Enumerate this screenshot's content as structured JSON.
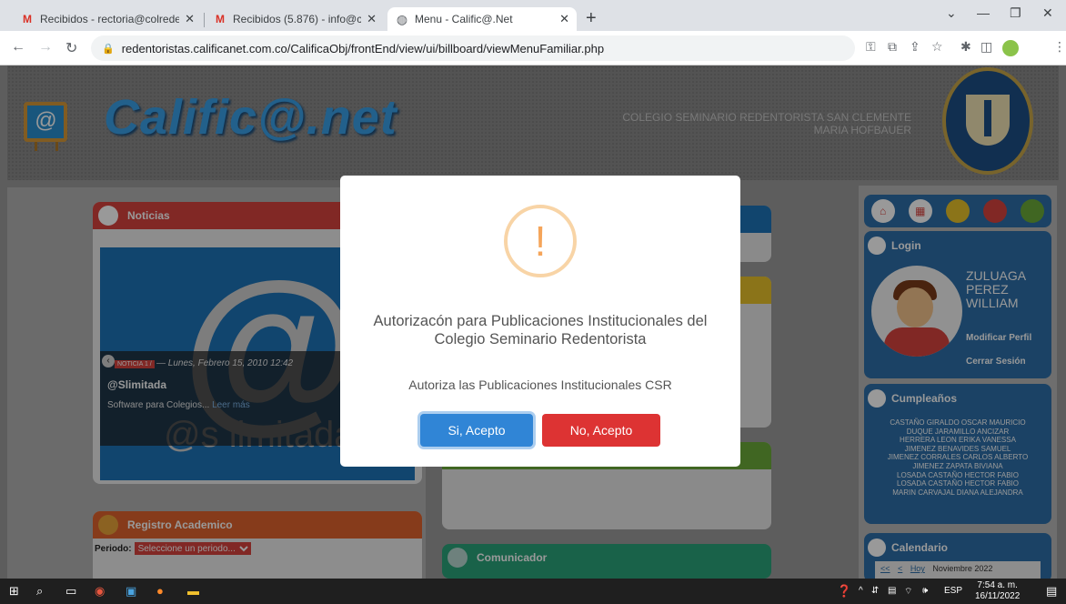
{
  "browser": {
    "tabs": [
      {
        "title": "Recibidos - rectoria@colredentor",
        "favicon": "gmail-icon",
        "active": false
      },
      {
        "title": "Recibidos (5.876) - info@colrede",
        "favicon": "gmail-icon",
        "active": false
      },
      {
        "title": "Menu - Calific@.Net",
        "favicon": "globe-icon",
        "active": true
      }
    ],
    "url": "redentoristas.calificanet.com.co/CalificaObj/frontEnd/view/ui/billboard/viewMenuFamiliar.php"
  },
  "header": {
    "logo_text": "Calific@.net",
    "school_line1": "COLEGIO SEMINARIO REDENTORISTA SAN CLEMENTE",
    "school_line2": "MARIA HOFBAUER"
  },
  "noticias": {
    "title": "Noticias",
    "slide_big_text": "@s",
    "slide_sub_text": "@s limitada",
    "badge": "NOTICIA 1 /",
    "date": "— Lunes, Febrero 15, 2010 12:42",
    "news_title": "@Slimitada",
    "news_desc": "Software para Colegios...",
    "read_more": "Leer más"
  },
  "registro": {
    "title": "Registro Academico",
    "periodo_label": "Periodo:",
    "periodo_selected": "Seleccione un periodo..."
  },
  "comunicador": {
    "title": "Comunicador"
  },
  "login": {
    "title": "Login",
    "name1": "ZULUAGA",
    "name2": "PEREZ",
    "name3": "WILLIAM",
    "edit_profile": "Modificar Perfil",
    "logout": "Cerrar Sesión"
  },
  "birthdays": {
    "title": "Cumpleaños",
    "names": [
      "CASTAÑO GIRALDO OSCAR MAURICIO",
      "DUQUE JARAMILLO ANCIZAR",
      "HERRERA LEON ERIKA VANESSA",
      "JIMENEZ BENAVIDES SAMUEL",
      "JIMENEZ CORRALES CARLOS ALBERTO",
      "JIMENEZ ZAPATA BIVIANA",
      "LOSADA CASTAÑO HECTOR FABIO",
      "LOSADA CASTAÑO HECTOR FABIO",
      "MARIN CARVAJAL DIANA ALEJANDRA"
    ]
  },
  "calendar": {
    "title": "Calendario",
    "nav_prev": "<<",
    "nav_next": "<",
    "today": "Hoy",
    "month": "Noviembre 2022"
  },
  "modal": {
    "icon": "!",
    "title": "Autorizacón para Publicaciones Institucionales del Colegio Seminario Redentorista",
    "text": "Autoriza las Publicaciones Institucionales CSR",
    "confirm": "Si, Acepto",
    "cancel": "No, Acepto"
  },
  "taskbar": {
    "lang": "ESP",
    "time": "7:54 a. m.",
    "date": "16/11/2022"
  },
  "colors": {
    "accent_blue": "#3085d6",
    "danger_red": "#dd3333",
    "panel_red": "#d8433f",
    "panel_blue": "#2d6fa8"
  }
}
